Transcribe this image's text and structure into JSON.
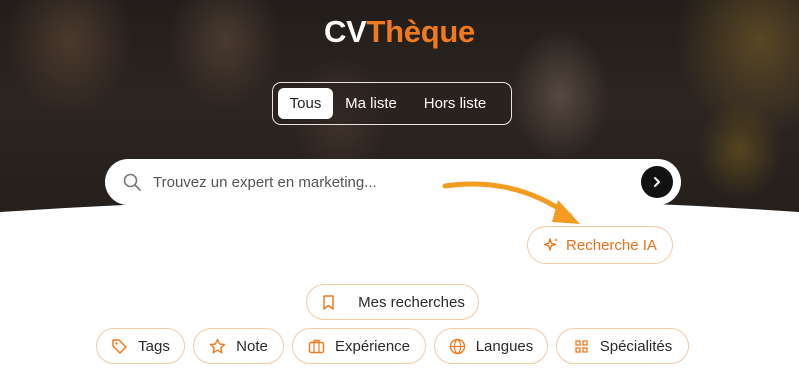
{
  "brand": {
    "part1": "CV",
    "part2": "Thèque"
  },
  "tabs": [
    {
      "label": "Tous",
      "active": true
    },
    {
      "label": "Ma liste",
      "active": false
    },
    {
      "label": "Hors liste",
      "active": false
    }
  ],
  "search": {
    "placeholder": "Trouvez un expert en marketing..."
  },
  "ai_search": {
    "label": "Recherche IA"
  },
  "saved_searches": {
    "label": "Mes recherches"
  },
  "filters": [
    {
      "label": "Tags",
      "icon": "tag-icon"
    },
    {
      "label": "Note",
      "icon": "star-icon"
    },
    {
      "label": "Expérience",
      "icon": "briefcase-icon"
    },
    {
      "label": "Langues",
      "icon": "globe-icon"
    },
    {
      "label": "Spécialités",
      "icon": "grid-icon"
    }
  ],
  "colors": {
    "accent": "#f07a1c",
    "pill_border": "#f3c9a3",
    "dark": "#111111"
  }
}
